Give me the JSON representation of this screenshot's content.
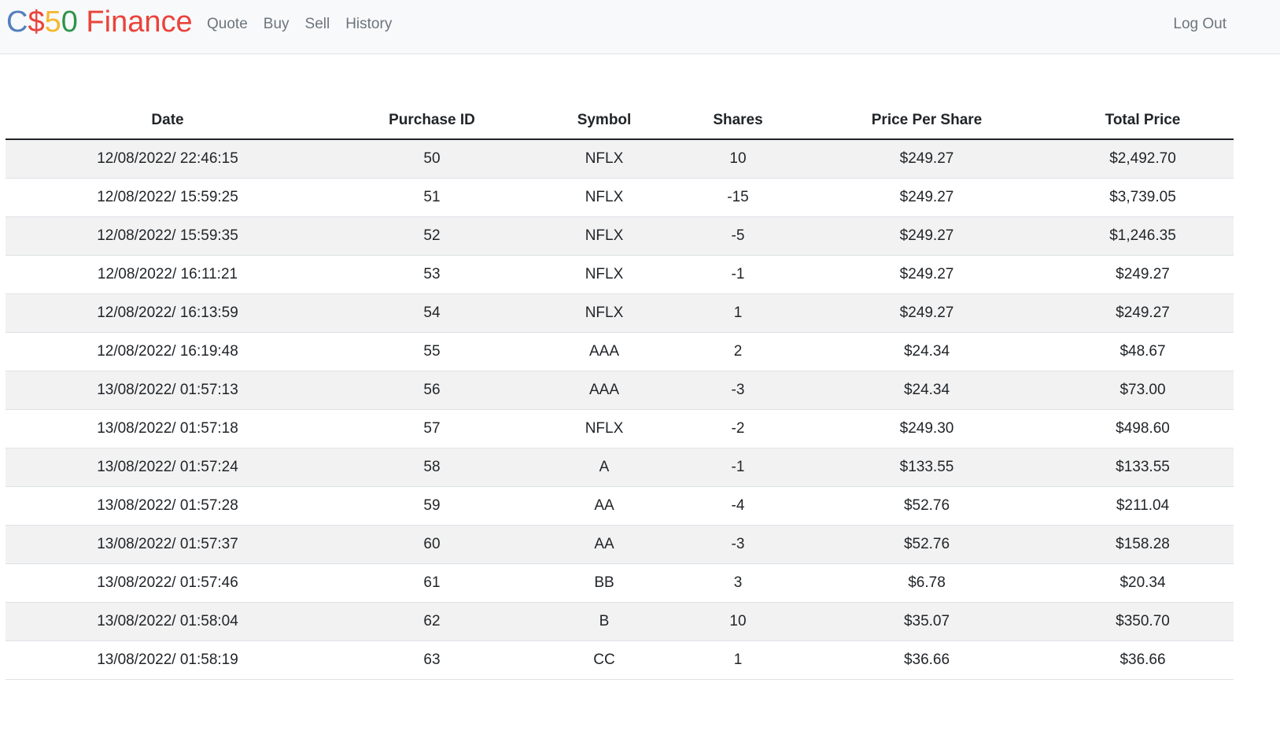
{
  "navbar": {
    "brand": {
      "c": "C",
      "dollar": "$",
      "five": "5",
      "zero": "0",
      "word": " Finance"
    },
    "links": [
      "Quote",
      "Buy",
      "Sell",
      "History"
    ],
    "logout": "Log Out"
  },
  "table": {
    "headers": [
      "Date",
      "Purchase ID",
      "Symbol",
      "Shares",
      "Price Per Share",
      "Total Price"
    ],
    "rows": [
      [
        "12/08/2022/ 22:46:15",
        "50",
        "NFLX",
        "10",
        "$249.27",
        "$2,492.70"
      ],
      [
        "12/08/2022/ 15:59:25",
        "51",
        "NFLX",
        "-15",
        "$249.27",
        "$3,739.05"
      ],
      [
        "12/08/2022/ 15:59:35",
        "52",
        "NFLX",
        "-5",
        "$249.27",
        "$1,246.35"
      ],
      [
        "12/08/2022/ 16:11:21",
        "53",
        "NFLX",
        "-1",
        "$249.27",
        "$249.27"
      ],
      [
        "12/08/2022/ 16:13:59",
        "54",
        "NFLX",
        "1",
        "$249.27",
        "$249.27"
      ],
      [
        "12/08/2022/ 16:19:48",
        "55",
        "AAA",
        "2",
        "$24.34",
        "$48.67"
      ],
      [
        "13/08/2022/ 01:57:13",
        "56",
        "AAA",
        "-3",
        "$24.34",
        "$73.00"
      ],
      [
        "13/08/2022/ 01:57:18",
        "57",
        "NFLX",
        "-2",
        "$249.30",
        "$498.60"
      ],
      [
        "13/08/2022/ 01:57:24",
        "58",
        "A",
        "-1",
        "$133.55",
        "$133.55"
      ],
      [
        "13/08/2022/ 01:57:28",
        "59",
        "AA",
        "-4",
        "$52.76",
        "$211.04"
      ],
      [
        "13/08/2022/ 01:57:37",
        "60",
        "AA",
        "-3",
        "$52.76",
        "$158.28"
      ],
      [
        "13/08/2022/ 01:57:46",
        "61",
        "BB",
        "3",
        "$6.78",
        "$20.34"
      ],
      [
        "13/08/2022/ 01:58:04",
        "62",
        "B",
        "10",
        "$35.07",
        "$350.70"
      ],
      [
        "13/08/2022/ 01:58:19",
        "63",
        "CC",
        "1",
        "$36.66",
        "$36.66"
      ]
    ]
  },
  "colors": {
    "brand_blue": "#537fbe",
    "brand_red": "#ea433b",
    "brand_yellow": "#f5b82e",
    "brand_green": "#2e944b",
    "navbar_bg": "#f8f9fa",
    "stripe": "#f2f2f2"
  }
}
